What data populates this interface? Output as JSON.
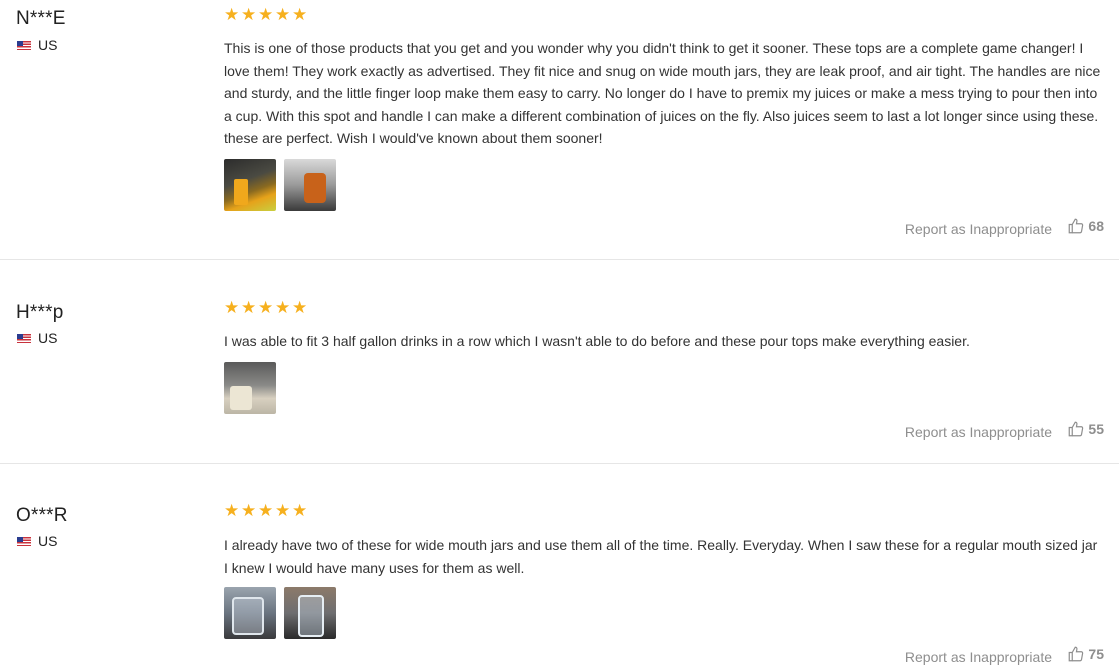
{
  "colors": {
    "star": "#f6b01e",
    "muted_text": "#8e8e8e",
    "divider": "#e6e6e6"
  },
  "icons": {
    "rating": "star-icon",
    "country": "us-flag-icon",
    "helpful": "thumbs-up-icon"
  },
  "reviews": [
    {
      "reviewer": "N***E",
      "country": "US",
      "rating": 5,
      "text": "This is one of those products that you get and you wonder why you didn't think to get it sooner. These tops are a complete game changer! I love them! They work exactly as advertised. They fit nice and snug on wide mouth jars, they are leak proof, and air tight. The handles are nice and sturdy, and the little finger loop make them easy to carry. No longer do I have to premix my juices or make a mess trying to pour then into a cup. With this spot and handle I can make a different combination of juices on the fly. Also juices seem to last a lot longer since using these. these are perfect. Wish I would've known about them sooner!",
      "photo_count": 2,
      "report_label": "Report as Inappropriate",
      "helpful_count": "68"
    },
    {
      "reviewer": "H***p",
      "country": "US",
      "rating": 5,
      "text": "I was able to fit 3 half gallon drinks in a row which I wasn't able to do before and these pour tops make everything easier.",
      "photo_count": 1,
      "report_label": "Report as Inappropriate",
      "helpful_count": "55"
    },
    {
      "reviewer": "O***R",
      "country": "US",
      "rating": 5,
      "text": "I already have two of these for wide mouth jars and use them all of the time. Really. Everyday. When I saw these for a regular mouth sized jar I knew I would have many uses for them as well.",
      "photo_count": 2,
      "report_label": "Report as Inappropriate",
      "helpful_count": "75"
    }
  ]
}
